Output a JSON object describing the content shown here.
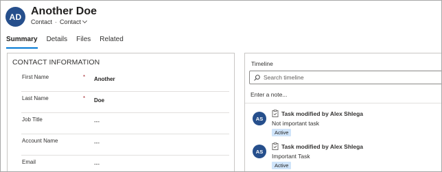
{
  "record": {
    "avatar_initials": "AD",
    "name": "Another Doe",
    "entity": "Contact",
    "form": "Contact",
    "accent_color": "#264f8c"
  },
  "tabs": [
    {
      "label": "Summary",
      "active": true
    },
    {
      "label": "Details",
      "active": false
    },
    {
      "label": "Files",
      "active": false
    },
    {
      "label": "Related",
      "active": false
    }
  ],
  "contact_info": {
    "section_title": "CONTACT INFORMATION",
    "fields": [
      {
        "label": "First Name",
        "required": true,
        "required_mark": "*",
        "value": "Another"
      },
      {
        "label": "Last Name",
        "required": true,
        "required_mark": "*",
        "value": "Doe"
      },
      {
        "label": "Job Title",
        "required": false,
        "value": "---"
      },
      {
        "label": "Account Name",
        "required": false,
        "value": "---"
      },
      {
        "label": "Email",
        "required": false,
        "value": "---"
      }
    ]
  },
  "timeline": {
    "title": "Timeline",
    "search_placeholder": "Search timeline",
    "note_placeholder": "Enter a note...",
    "items": [
      {
        "avatar": "AS",
        "icon": "task-icon",
        "header": "Task modified by Alex Shlega",
        "body": "Not important task",
        "status": "Active"
      },
      {
        "avatar": "AS",
        "icon": "task-icon",
        "header": "Task modified by Alex Shlega",
        "body": "Important Task",
        "status": "Active"
      }
    ]
  }
}
